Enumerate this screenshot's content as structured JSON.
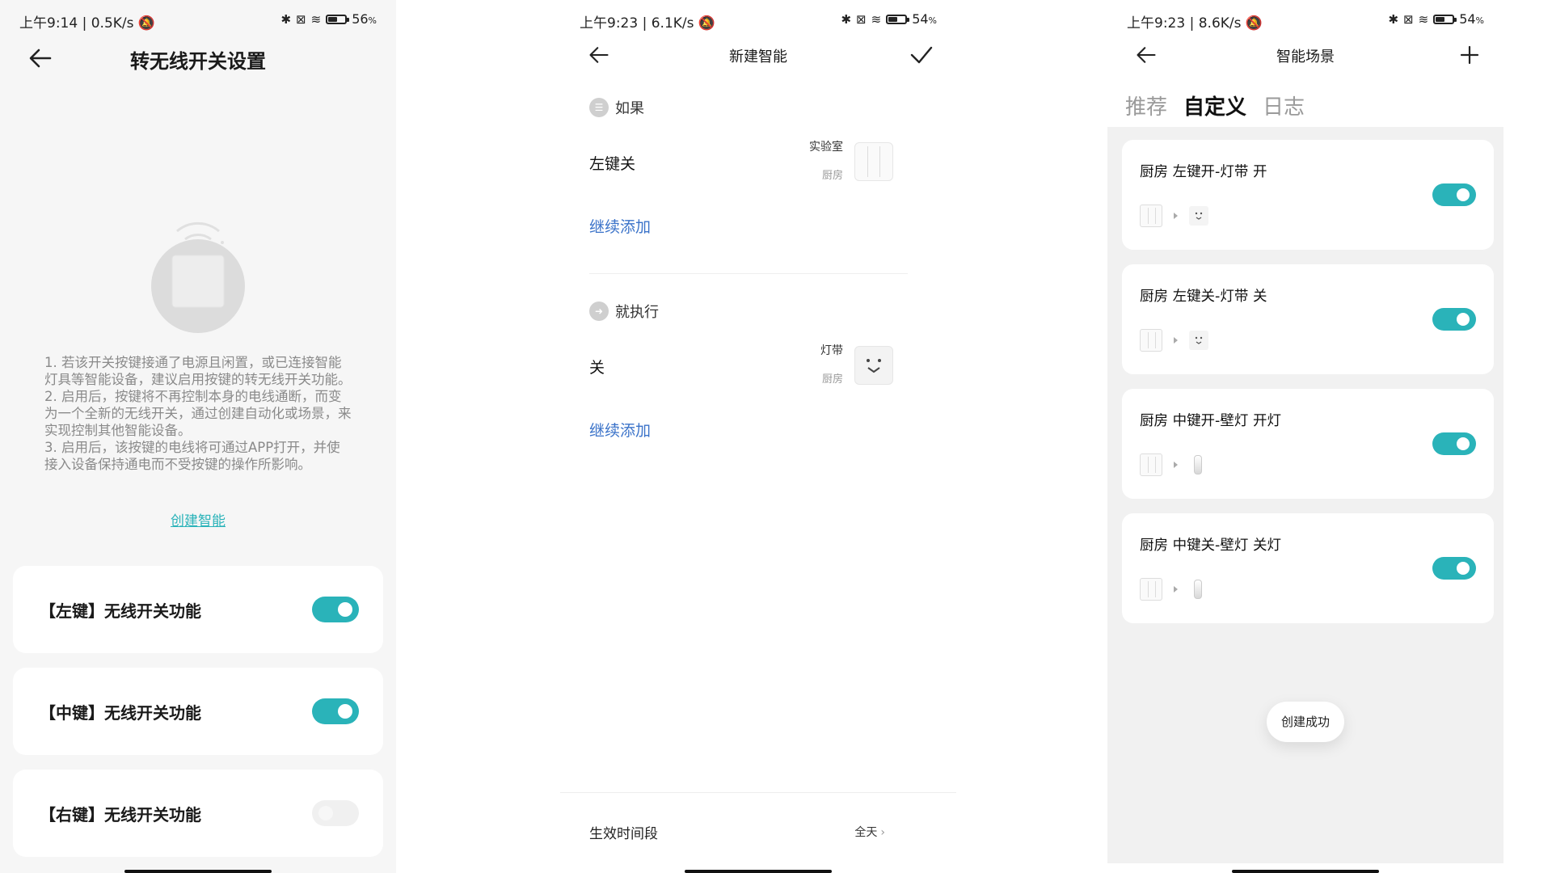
{
  "screens": {
    "settings": {
      "status": {
        "time": "上午9:14",
        "speed": "0.5K/s",
        "battery": "56",
        "battery_unit": "%",
        "battery_level": 0.56
      },
      "title": "转无线开关设置",
      "desc": [
        "1. 若该开关按键接通了电源且闲置，或已连接智能灯具等智能设备，建议启用按键的转无线开关功能。",
        "2. 启用后，按键将不再控制本身的电线通断，而变为一个全新的无线开关，通过创建自动化或场景，来实现控制其他智能设备。",
        "3. 启用后，该按键的电线将可通过APP打开，并使接入设备保持通电而不受按键的操作所影响。"
      ],
      "create_link": "创建智能",
      "toggles": [
        {
          "label": "【左键】无线开关功能",
          "on": true
        },
        {
          "label": "【中键】无线开关功能",
          "on": true
        },
        {
          "label": "【右键】无线开关功能",
          "on": false
        }
      ]
    },
    "new_smart": {
      "status": {
        "time": "上午9:23",
        "speed": "6.1K/s",
        "battery": "54",
        "battery_unit": "%",
        "battery_level": 0.54
      },
      "title": "新建智能",
      "if_section": {
        "label": "如果",
        "row": {
          "main": "左键关",
          "device": "实验室",
          "room": "厨房"
        },
        "add": "继续添加"
      },
      "then_section": {
        "label": "就执行",
        "row": {
          "main": "关",
          "device": "灯带",
          "room": "厨房"
        },
        "add": "继续添加"
      },
      "footer": {
        "label": "生效时间段",
        "value": "全天"
      }
    },
    "scenes": {
      "status": {
        "time": "上午9:23",
        "speed": "8.6K/s",
        "battery": "54",
        "battery_unit": "%",
        "battery_level": 0.54
      },
      "title": "智能场景",
      "tabs": [
        "推荐",
        "自定义",
        "日志"
      ],
      "active_tab": 1,
      "items": [
        {
          "name": "厨房 左键开-灯带 开",
          "target": "socket",
          "on": true
        },
        {
          "name": "厨房 左键关-灯带 关",
          "target": "socket",
          "on": true
        },
        {
          "name": "厨房 中键开-壁灯 开灯",
          "target": "bulb",
          "on": true
        },
        {
          "name": "厨房 中键关-壁灯 关灯",
          "target": "bulb",
          "on": true
        }
      ],
      "toast": "创建成功"
    }
  },
  "colors": {
    "accent": "#2ab3b9",
    "link_blue": "#3b73c9",
    "toggle_off": "#f0f0f0"
  }
}
